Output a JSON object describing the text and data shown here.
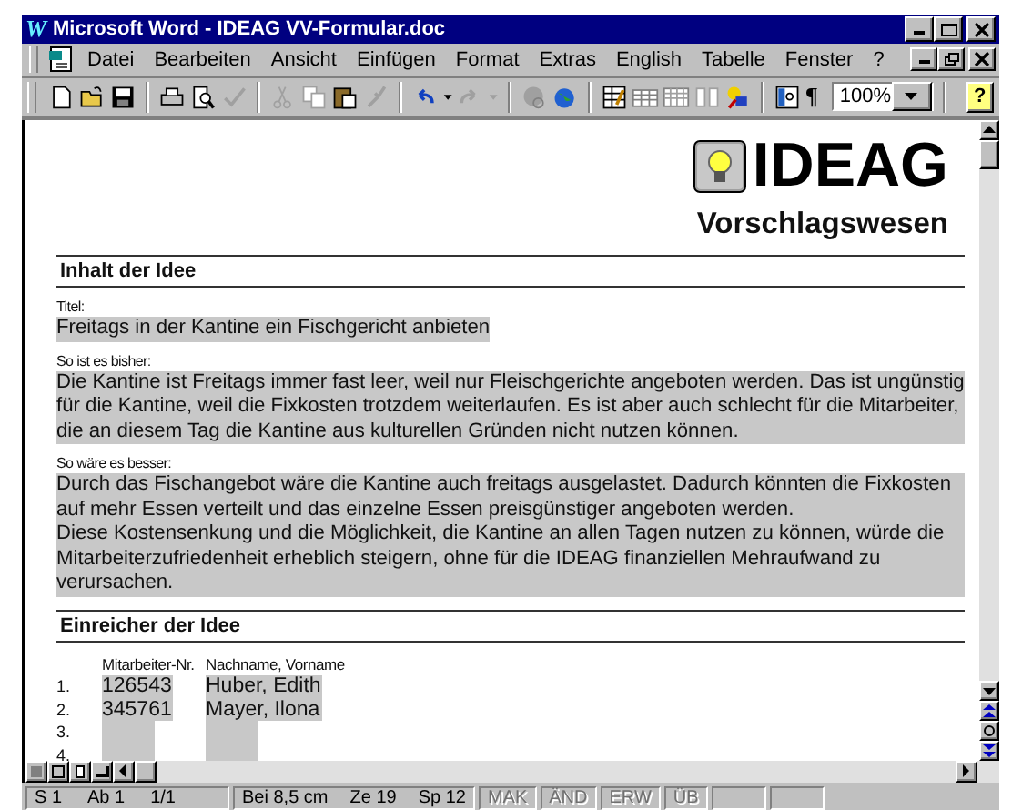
{
  "window": {
    "logo": "W",
    "title": "Microsoft Word - IDEAG VV-Formular.doc"
  },
  "menu": [
    "Datei",
    "Bearbeiten",
    "Ansicht",
    "Einfügen",
    "Format",
    "Extras",
    "English",
    "Tabelle",
    "Fenster",
    "?"
  ],
  "toolbar": {
    "pilcrow": "¶",
    "zoom": "100%",
    "help": "?"
  },
  "document": {
    "brand": "IDEAG",
    "subtitle": "Vorschlagswesen",
    "sections": [
      {
        "kind": "fields",
        "heading": "Inhalt der Idee",
        "fields": [
          {
            "label": "Titel:",
            "paragraphs": [
              "Freitags in der Kantine ein Fischgericht anbieten"
            ]
          },
          {
            "label": "So ist es bisher:",
            "paragraphs": [
              "Die Kantine ist Freitags immer fast leer, weil nur Fleischgerichte angeboten werden. Das ist ungünstig für die Kantine, weil die Fixkosten trotzdem weiterlaufen. Es ist aber auch schlecht für die Mitarbeiter, die an diesem Tag die Kantine aus kulturellen Gründen nicht nutzen können."
            ]
          },
          {
            "label": "So wäre es besser:",
            "paragraphs": [
              "Durch das Fischangebot wäre die Kantine auch freitags ausgelastet. Dadurch könnten die Fixkosten auf mehr Essen verteilt und das einzelne Essen preisgünstiger angeboten werden.",
              "Diese Kostensenkung und die Möglichkeit, die Kantine an allen Tagen nutzen zu können, würde die Mitarbeiterzufriedenheit erheblich steigern, ohne für die IDEAG finanziellen Mehraufwand zu verursachen."
            ]
          }
        ]
      },
      {
        "kind": "table",
        "heading": "Einreicher der Idee",
        "columns": [
          "Mitarbeiter-Nr.",
          "Nachname, Vorname"
        ],
        "rows": [
          {
            "number": "1.",
            "id": "126543",
            "name": "Huber, Edith"
          },
          {
            "number": "2.",
            "id": "345761",
            "name": "Mayer, Ilona"
          },
          {
            "number": "3."
          },
          {
            "number": "4."
          }
        ]
      }
    ]
  },
  "status_bar": [
    {
      "items": [
        "S 1",
        "Ab 1",
        "1/1"
      ],
      "disabled": false
    },
    {
      "items": [
        "Bei 8,5 cm",
        "Ze 19",
        "Sp 12"
      ],
      "disabled": false
    },
    {
      "items": [
        "MAK"
      ],
      "disabled": true
    },
    {
      "items": [
        "ÄND"
      ],
      "disabled": true
    },
    {
      "items": [
        "ERW"
      ],
      "disabled": true
    },
    {
      "items": [
        "ÜB"
      ],
      "disabled": true
    }
  ]
}
